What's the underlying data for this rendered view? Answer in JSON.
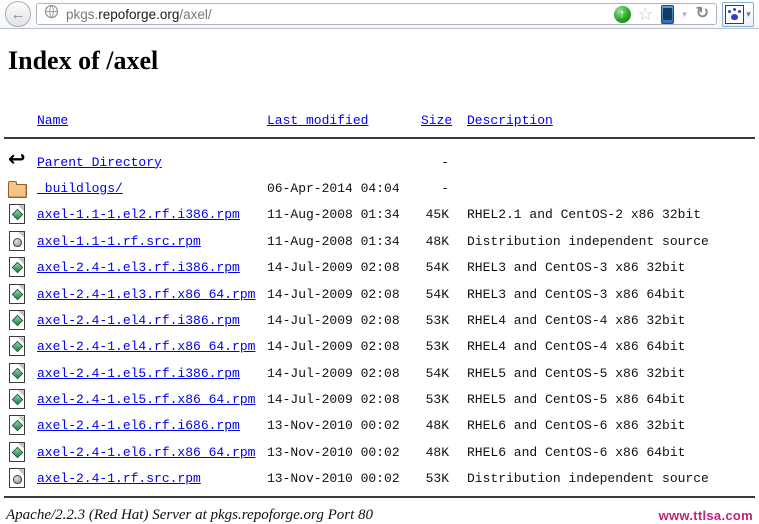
{
  "browser": {
    "back_glyph": "←",
    "url": {
      "prefix": "pkgs.",
      "domain": "repoforge.org",
      "path": "/axel/"
    },
    "icons": {
      "go_glyph": "↑",
      "star_glyph": "☆",
      "dropdown_glyph": "▼",
      "reload_glyph": "↻",
      "addon_caret_glyph": "▾"
    }
  },
  "listing": {
    "title": "Index of /axel",
    "columns": {
      "name": "Name",
      "last_modified": "Last modified",
      "size": "Size",
      "description": "Description"
    },
    "rows": [
      {
        "icon": "back-arrow",
        "name": "Parent Directory",
        "modified": "",
        "size": "-",
        "description": ""
      },
      {
        "icon": "folder",
        "name": "_buildlogs/",
        "modified": "06-Apr-2014 04:04",
        "size": "-",
        "description": ""
      },
      {
        "icon": "rpm-file",
        "name": "axel-1.1-1.el2.rf.i386.rpm",
        "modified": "11-Aug-2008 01:34",
        "size": "45K",
        "description": "RHEL2.1 and CentOS-2 x86 32bit"
      },
      {
        "icon": "src-file",
        "name": "axel-1.1-1.rf.src.rpm",
        "modified": "11-Aug-2008 01:34",
        "size": "48K",
        "description": "Distribution independent source"
      },
      {
        "icon": "rpm-file",
        "name": "axel-2.4-1.el3.rf.i386.rpm",
        "modified": "14-Jul-2009 02:08",
        "size": "54K",
        "description": "RHEL3 and CentOS-3 x86 32bit"
      },
      {
        "icon": "rpm-file",
        "name": "axel-2.4-1.el3.rf.x86_64.rpm",
        "modified": "14-Jul-2009 02:08",
        "size": "54K",
        "description": "RHEL3 and CentOS-3 x86 64bit"
      },
      {
        "icon": "rpm-file",
        "name": "axel-2.4-1.el4.rf.i386.rpm",
        "modified": "14-Jul-2009 02:08",
        "size": "53K",
        "description": "RHEL4 and CentOS-4 x86 32bit"
      },
      {
        "icon": "rpm-file",
        "name": "axel-2.4-1.el4.rf.x86_64.rpm",
        "modified": "14-Jul-2009 02:08",
        "size": "53K",
        "description": "RHEL4 and CentOS-4 x86 64bit"
      },
      {
        "icon": "rpm-file",
        "name": "axel-2.4-1.el5.rf.i386.rpm",
        "modified": "14-Jul-2009 02:08",
        "size": "54K",
        "description": "RHEL5 and CentOS-5 x86 32bit"
      },
      {
        "icon": "rpm-file",
        "name": "axel-2.4-1.el5.rf.x86_64.rpm",
        "modified": "14-Jul-2009 02:08",
        "size": "53K",
        "description": "RHEL5 and CentOS-5 x86 64bit"
      },
      {
        "icon": "rpm-file",
        "name": "axel-2.4-1.el6.rf.i686.rpm",
        "modified": "13-Nov-2010 00:02",
        "size": "48K",
        "description": "RHEL6 and CentOS-6 x86 32bit"
      },
      {
        "icon": "rpm-file",
        "name": "axel-2.4-1.el6.rf.x86_64.rpm",
        "modified": "13-Nov-2010 00:02",
        "size": "48K",
        "description": "RHEL6 and CentOS-6 x86 64bit"
      },
      {
        "icon": "src-file",
        "name": "axel-2.4-1.rf.src.rpm",
        "modified": "13-Nov-2010 00:02",
        "size": "53K",
        "description": "Distribution independent source"
      }
    ],
    "footer": "Apache/2.2.3 (Red Hat) Server at pkgs.repoforge.org Port 80",
    "watermark": "www.ttlsa.com"
  },
  "colors": {
    "link": "#0000ee",
    "watermark": "#c2217c",
    "folder": "#f3c488",
    "rpm_green": "#1e7a45"
  }
}
